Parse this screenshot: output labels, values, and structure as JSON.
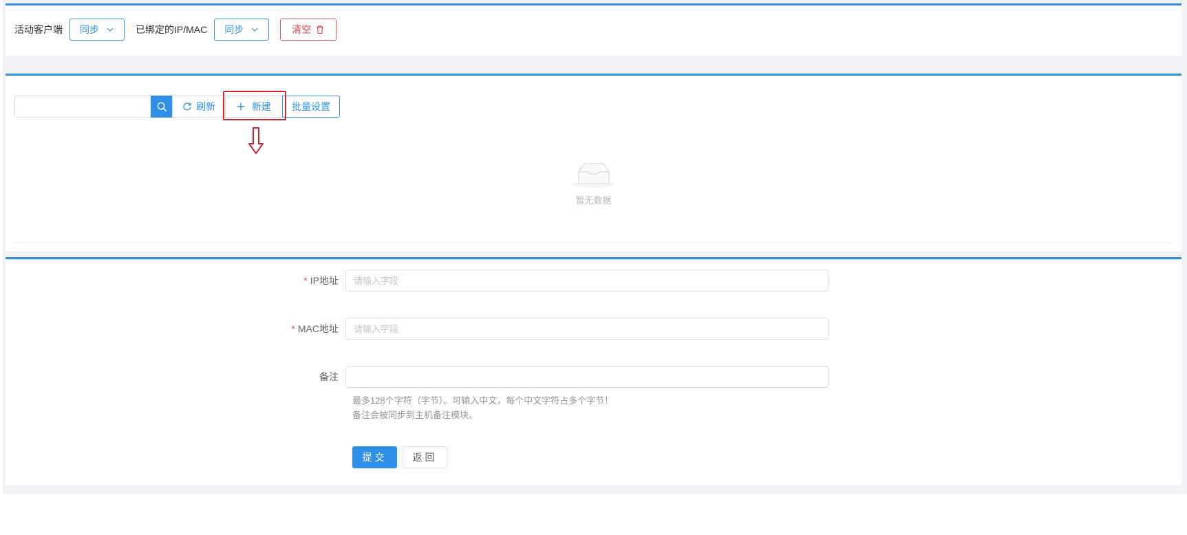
{
  "top_bar": {
    "active_clients_label": "活动客户端",
    "active_sync_label": "同步",
    "bound_label": "已绑定的IP/MAC",
    "bound_sync_label": "同步",
    "clear_label": "清空"
  },
  "toolbar": {
    "search_placeholder": "",
    "refresh_label": "刷新",
    "new_label": "新建",
    "batch_label": "批量设置"
  },
  "table": {
    "empty_text": "暂无数据"
  },
  "form": {
    "ip_label": "IP地址",
    "ip_placeholder": "请输入字段",
    "mac_label": "MAC地址",
    "mac_placeholder": "请输入字段",
    "remark_label": "备注",
    "remark_value": "",
    "hint_line1": "最多128个字符（字节）。可输入中文，每个中文字符占多个字节！",
    "hint_line2": "备注会被同步到主机备注模块。",
    "required_mark": "*",
    "submit_label": "提交",
    "back_label": "返回"
  },
  "colors": {
    "accent": "#2d8fe8",
    "danger": "#e5484d",
    "highlight": "#c9252c"
  }
}
